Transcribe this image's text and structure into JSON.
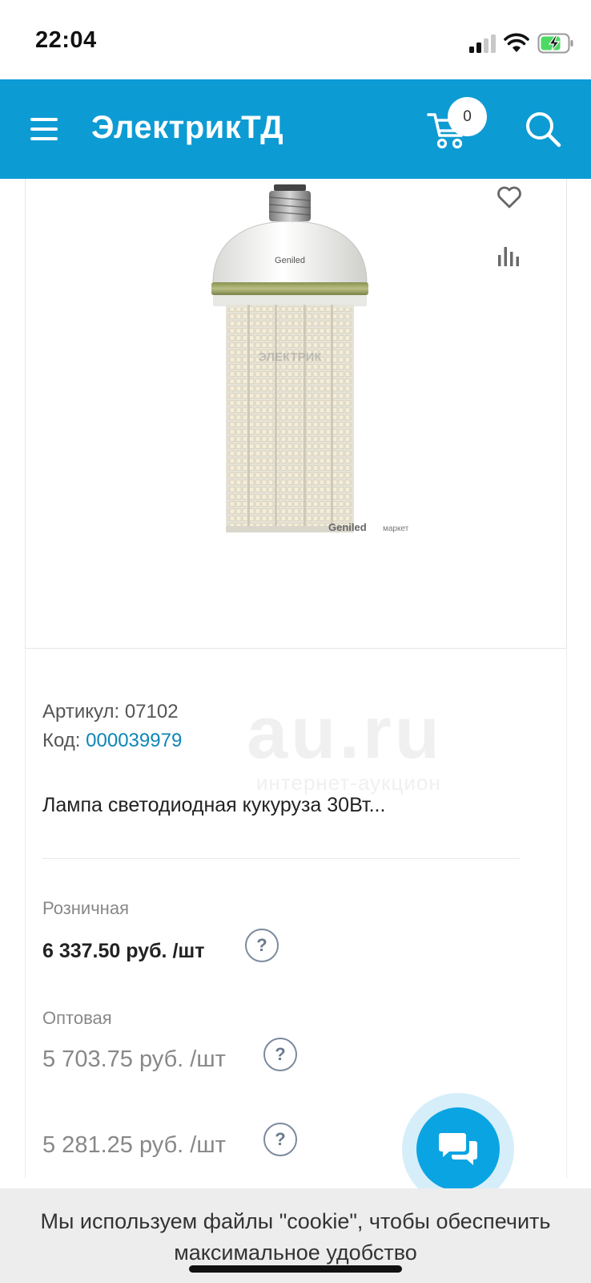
{
  "status_bar": {
    "time": "22:04",
    "signal_icon": "cellular-signal-icon",
    "wifi_icon": "wifi-icon",
    "battery_icon": "battery-charging-icon"
  },
  "header": {
    "logo": "ЭлектрикТД",
    "menu_icon": "hamburger-menu-icon",
    "cart_icon": "cart-icon",
    "cart_count": "0",
    "search_icon": "search-icon",
    "background_color": "#0d9bd4"
  },
  "product_image": {
    "brand_cap_text": "Geniled",
    "brand_caption_brand": "Geniled",
    "brand_caption_suffix": "маркет",
    "watermark": "ЭЛЕКТРИК",
    "favorite_icon": "heart-icon",
    "compare_icon": "bar-chart-icon"
  },
  "watermark": {
    "big": "au.ru",
    "small": "интернет-аукцион"
  },
  "product": {
    "sku_label": "Артикул:",
    "sku_value": "07102",
    "code_label": "Код:",
    "code_value": "000039979",
    "title": "Лампа светодиодная кукуруза 30Вт..."
  },
  "prices": {
    "retail_label": "Розничная",
    "retail_value": "6 337.50 руб. /шт",
    "wholesale_label": "Оптовая",
    "wholesale_value": "5 703.75 руб. /шт",
    "tier_value": "5 281.25 руб. /шт",
    "help_symbol": "?"
  },
  "chat": {
    "icon": "chat-bubbles-icon",
    "accent_color": "#0aa4e3"
  },
  "cookie": {
    "text": "Мы используем файлы \"cookie\", чтобы обеспечить максимальное удобство"
  }
}
